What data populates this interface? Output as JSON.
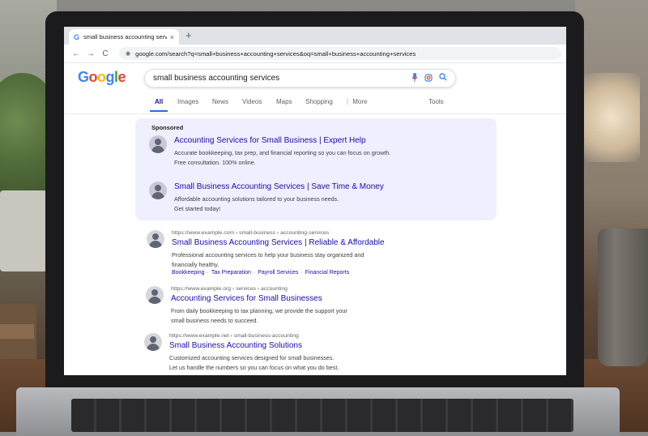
{
  "browser": {
    "tab_title": "small business accounting services -",
    "tab_favicon": "G",
    "tab_close": "×",
    "new_tab": "+",
    "back": "←",
    "forward": "→",
    "reload": "C",
    "url": "google.com/search?q=small+business+accounting+services&oq=small+business+accounting+services"
  },
  "google": {
    "logo": [
      "G",
      "o",
      "o",
      "g",
      "l",
      "e"
    ],
    "logo_colors": [
      "#4285f4",
      "#ea4335",
      "#fbbc05",
      "#4285f4",
      "#34a853",
      "#ea4335"
    ],
    "query": "small business accounting services",
    "tabs": [
      "All",
      "Images",
      "News",
      "Videos",
      "Maps",
      "Shopping",
      "⋮ More"
    ],
    "tools": "Tools"
  },
  "sponsored": {
    "label": "Sponsored",
    "ads": [
      {
        "title": "Accounting Services for Small Business | Expert Help",
        "desc_line1": "Accurate bookkeeping, tax prep, and financial reporting so you can focus on growth.",
        "desc_line2": "Free consultation. 100% online."
      },
      {
        "title": "Small Business Accounting Services | Save Time & Money",
        "desc_line1": "Affordable accounting solutions tailored to your business needs.",
        "desc_line2": "Get started today!"
      }
    ]
  },
  "results": [
    {
      "url": "https://www.example.com › small-business › accounting-services",
      "title": "Small Business Accounting Services | Reliable & Affordable",
      "desc_line1": "Professional accounting services to help your business stay organized and",
      "desc_line2": "financially healthy.",
      "sitelinks": [
        "Bookkeeping",
        "Tax Preparation",
        "Payroll Services",
        "Financial Reports"
      ],
      "sitelink_sep": "·"
    },
    {
      "url": "https://www.example.org › services › accounting",
      "title": "Accounting Services for Small Businesses",
      "desc_line1": "From daily bookkeeping to tax planning, we provide the support your",
      "desc_line2": "small business needs to succeed."
    },
    {
      "url": "https://www.example.net › small-business-accounting",
      "title": "Small Business Accounting Solutions",
      "desc_line1": "Customized accounting services designed for small businesses.",
      "desc_line2": "Let us handle the numbers so you can focus on what you do best."
    }
  ]
}
